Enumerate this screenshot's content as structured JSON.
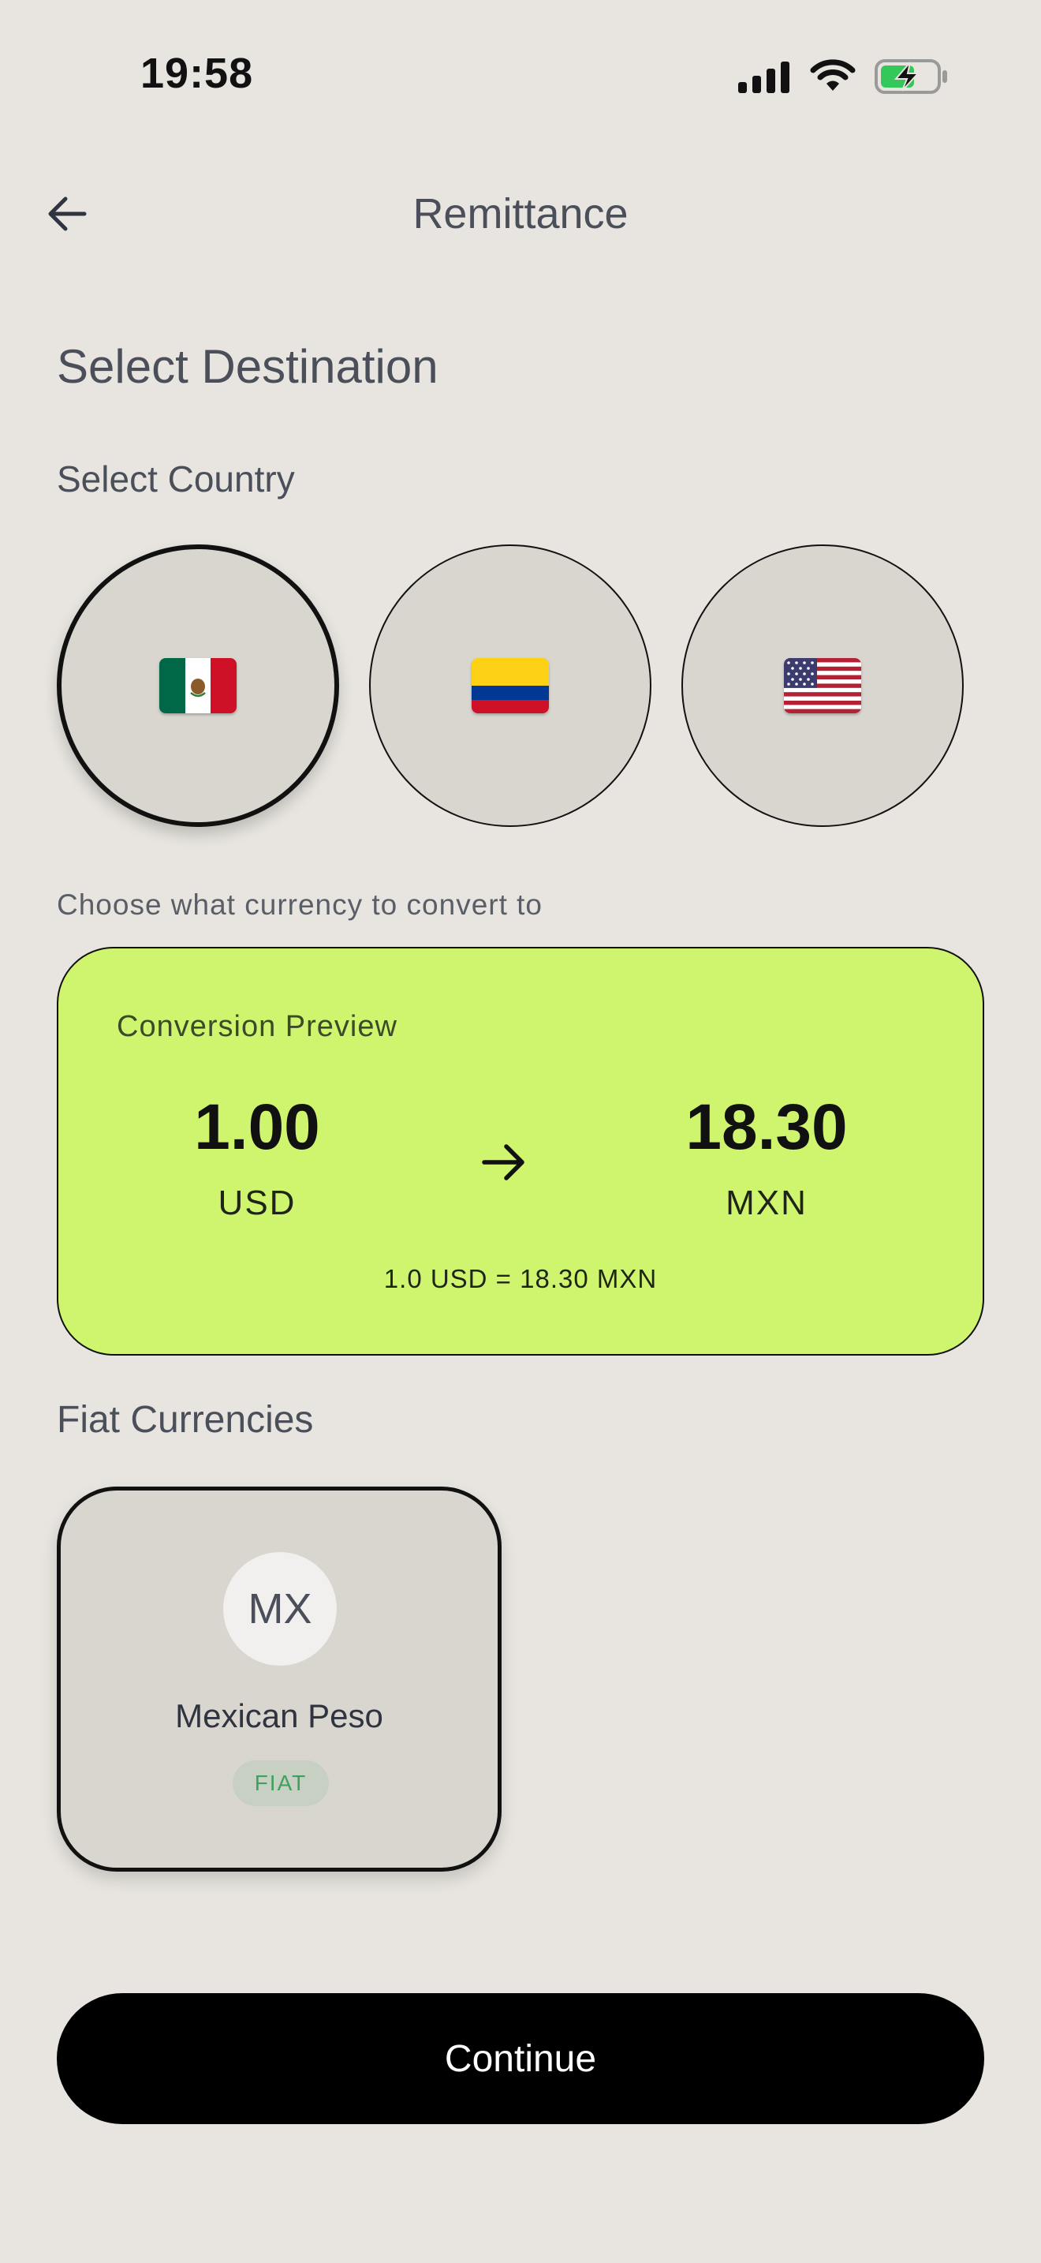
{
  "status_bar": {
    "time": "19:58"
  },
  "header": {
    "title": "Remittance"
  },
  "page": {
    "heading": "Select Destination",
    "country_label": "Select Country",
    "currency_hint": "Choose what currency to convert to"
  },
  "countries": [
    {
      "name": "Mexico",
      "flag": "mexico-flag-icon",
      "selected": true
    },
    {
      "name": "Colombia",
      "flag": "colombia-flag-icon",
      "selected": false
    },
    {
      "name": "United States",
      "flag": "us-flag-icon",
      "selected": false
    }
  ],
  "conversion": {
    "title": "Conversion Preview",
    "from_amount": "1.00",
    "from_code": "USD",
    "to_amount": "18.30",
    "to_code": "MXN",
    "rate_text": "1.0 USD = 18.30 MXN",
    "card_color": "#cff56f"
  },
  "fiat": {
    "heading": "Fiat Currencies",
    "items": [
      {
        "initials": "MX",
        "name": "Mexican Peso",
        "badge": "FIAT",
        "selected": true
      }
    ]
  },
  "actions": {
    "continue_label": "Continue"
  }
}
